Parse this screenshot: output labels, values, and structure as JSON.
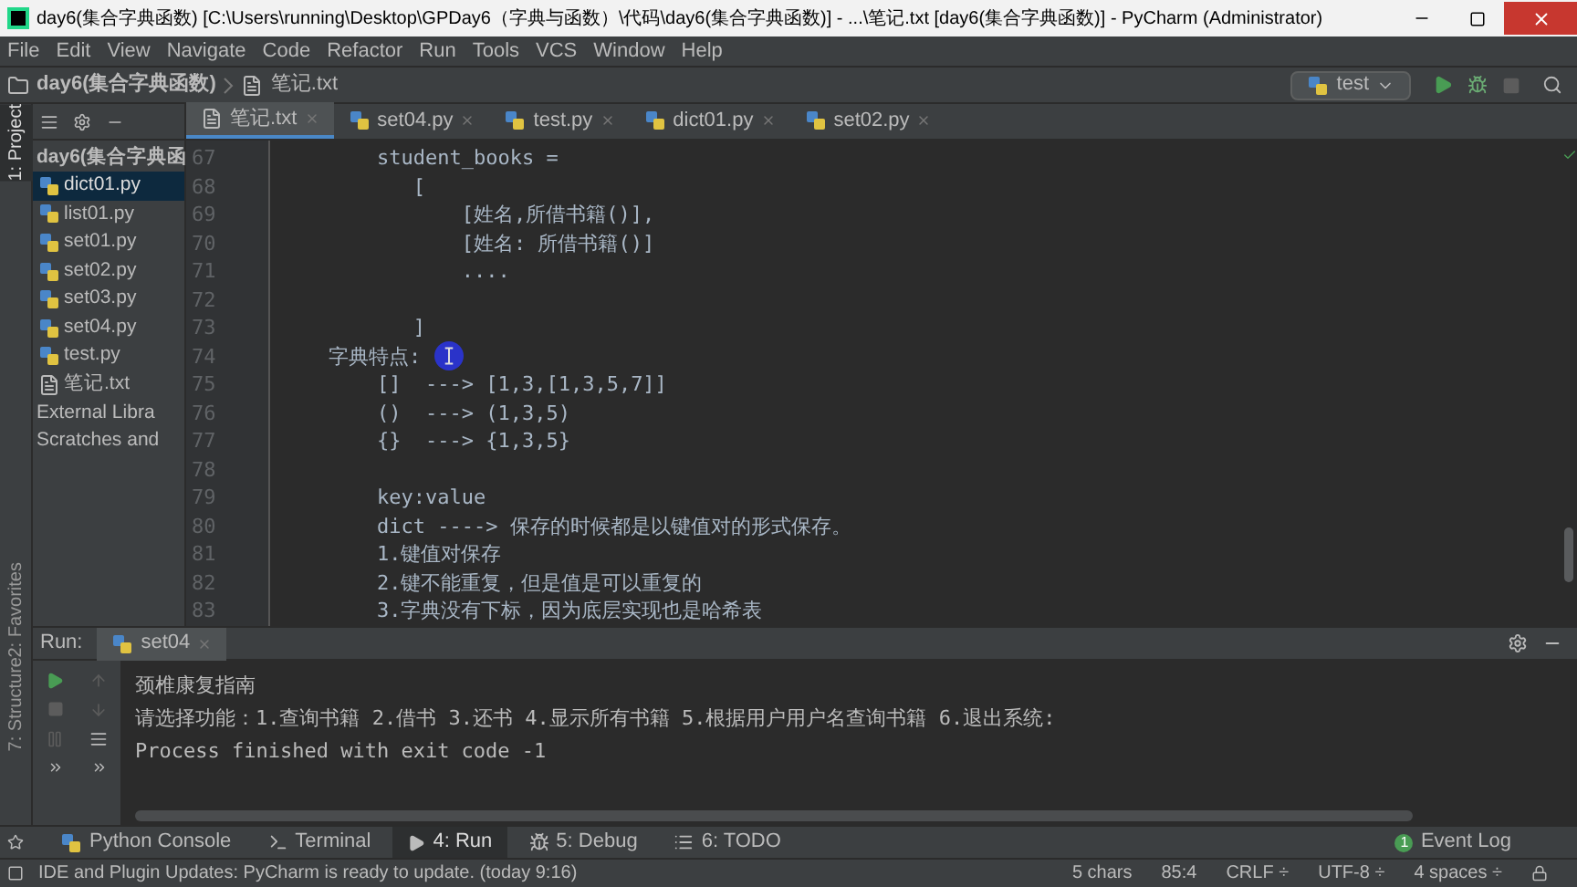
{
  "window": {
    "title": "day6(集合字典函数) [C:\\Users\\running\\Desktop\\GPDay6（字典与函数）\\代码\\day6(集合字典函数)] - ...\\笔记.txt [day6(集合字典函数)] - PyCharm (Administrator)"
  },
  "menu": [
    "File",
    "Edit",
    "View",
    "Navigate",
    "Code",
    "Refactor",
    "Run",
    "Tools",
    "VCS",
    "Window",
    "Help"
  ],
  "breadcrumb": [
    {
      "kind": "folder",
      "text": "day6(集合字典函数)"
    },
    {
      "kind": "txt",
      "text": "笔记.txt"
    }
  ],
  "run_config": "test",
  "side_tabs": [
    {
      "label": "1: Project",
      "selected": true
    },
    {
      "label": "2: Favorites",
      "selected": false
    },
    {
      "label": "7: Structure",
      "selected": false
    }
  ],
  "project": {
    "root": "day6(集合字典函",
    "files": [
      {
        "name": "dict01.py",
        "kind": "py",
        "selected": true
      },
      {
        "name": "list01.py",
        "kind": "py",
        "selected": false
      },
      {
        "name": "set01.py",
        "kind": "py",
        "selected": false
      },
      {
        "name": "set02.py",
        "kind": "py",
        "selected": false
      },
      {
        "name": "set03.py",
        "kind": "py",
        "selected": false
      },
      {
        "name": "set04.py",
        "kind": "py",
        "selected": false
      },
      {
        "name": "test.py",
        "kind": "py",
        "selected": false
      },
      {
        "name": "笔记.txt",
        "kind": "txt",
        "selected": false
      }
    ],
    "extras": [
      "External Libra",
      "Scratches and"
    ]
  },
  "editor_tabs": [
    {
      "label": "笔记.txt",
      "kind": "txt",
      "selected": true
    },
    {
      "label": "set04.py",
      "kind": "py",
      "selected": false
    },
    {
      "label": "test.py",
      "kind": "py",
      "selected": false
    },
    {
      "label": "dict01.py",
      "kind": "py",
      "selected": false
    },
    {
      "label": "set02.py",
      "kind": "py",
      "selected": false
    }
  ],
  "lines": [
    {
      "number": "67",
      "text": "    student_books ="
    },
    {
      "number": "68",
      "text": "       ["
    },
    {
      "number": "69",
      "text": "           [姓名,所借书籍()],"
    },
    {
      "number": "70",
      "text": "           [姓名: 所借书籍()]"
    },
    {
      "number": "71",
      "text": "           ...."
    },
    {
      "number": "72"
    },
    {
      "number": "73",
      "text": "       ]"
    },
    {
      "number": "74",
      "text": "字典特点:"
    },
    {
      "number": "75",
      "text": "    []  ---> [1,3,[1,3,5,7]]"
    },
    {
      "number": "76",
      "text": "    ()  ---> (1,3,5)"
    },
    {
      "number": "77",
      "text": "    {}  ---> {1,3,5}"
    },
    {
      "number": "78"
    },
    {
      "number": "79",
      "text": "    key:value"
    },
    {
      "number": "80",
      "text": "    dict ----> 保存的时候都是以键值对的形式保存。"
    },
    {
      "number": "81",
      "text": "    1.键值对保存"
    },
    {
      "number": "82",
      "text": "    2.键不能重复，但是值是可以重复的"
    },
    {
      "number": "83",
      "text": "    3.字典没有下标，因为底层实现也是哈希表"
    }
  ],
  "run_panel": {
    "label": "Run:",
    "tab": "set04",
    "output": [
      "颈椎康复指南",
      "请选择功能：1.查询书籍 2.借书 3.还书 4.显示所有书籍 5.根据用户用户名查询书籍 6.退出系统:",
      "Process finished with exit code -1"
    ]
  },
  "tool_windows": [
    {
      "label": "Python Console",
      "kind": "python",
      "selected": false
    },
    {
      "label": "Terminal",
      "kind": "terminal",
      "selected": false
    },
    {
      "label": "4: Run",
      "kind": "run",
      "selected": true
    },
    {
      "label": "5: Debug",
      "kind": "debug",
      "selected": false
    },
    {
      "label": "6: TODO",
      "kind": "todo",
      "selected": false
    }
  ],
  "event_log": {
    "label": "Event Log",
    "count": "1"
  },
  "status": {
    "message": "IDE and Plugin Updates: PyCharm is ready to update. (today 9:16)",
    "items": [
      "5 chars",
      "85:4",
      "CRLF ÷",
      "UTF-8 ÷",
      "4 spaces ÷"
    ]
  }
}
